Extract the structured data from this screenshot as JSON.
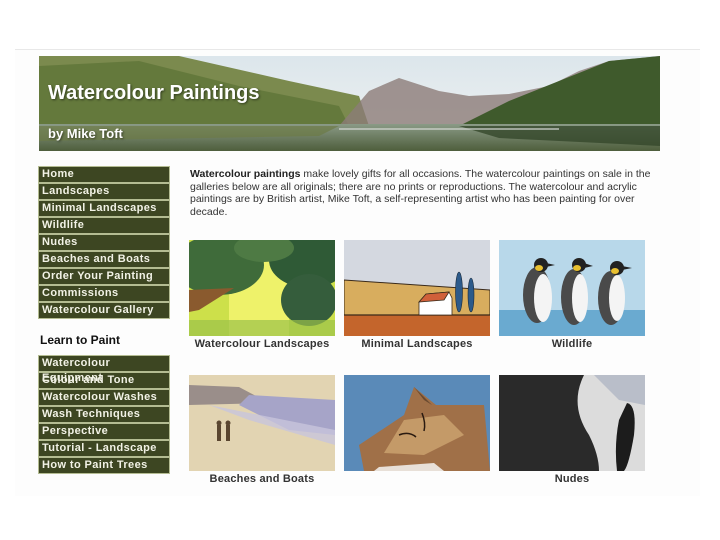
{
  "header": {
    "title": "Watercolour Paintings",
    "subtitle": "by Mike Toft"
  },
  "nav_main": [
    {
      "label": "Home"
    },
    {
      "label": "Landscapes"
    },
    {
      "label": "Minimal Landscapes"
    },
    {
      "label": "Wildlife"
    },
    {
      "label": "Nudes"
    },
    {
      "label": "Beaches and Boats"
    },
    {
      "label": "Order Your Painting"
    },
    {
      "label": "Commissions"
    },
    {
      "label": "Watercolour Gallery"
    }
  ],
  "learn_heading": "Learn to Paint",
  "nav_learn": [
    {
      "label": "Watercolour Equipment"
    },
    {
      "label": "Colour and Tone"
    },
    {
      "label": "Watercolour Washes"
    },
    {
      "label": "Wash Techniques"
    },
    {
      "label": "Perspective"
    },
    {
      "label": "Tutorial - Landscape"
    },
    {
      "label": "How to Paint Trees"
    }
  ],
  "intro": {
    "bold": "Watercolour paintings",
    "text": " make lovely gifts for all occasions. The watercolour paintings on sale in the galleries below are all originals; there are no prints or reproductions. The watercolour and acrylic paintings are by British artist, Mike Toft, a self-representing artist who has been painting for over decade."
  },
  "gallery": [
    {
      "caption": "Watercolour Landscapes",
      "image": "green-trees-river-painting"
    },
    {
      "caption": "Minimal Landscapes",
      "image": "house-cypress-field-painting"
    },
    {
      "caption": "Wildlife",
      "image": "three-penguins-painting"
    },
    {
      "caption": "Beaches and Boats",
      "image": "couple-walking-beach-painting"
    },
    {
      "caption": "",
      "image": "sleeping-cat-painting"
    },
    {
      "caption": "Nudes",
      "image": "abstract-figure-painting"
    }
  ]
}
